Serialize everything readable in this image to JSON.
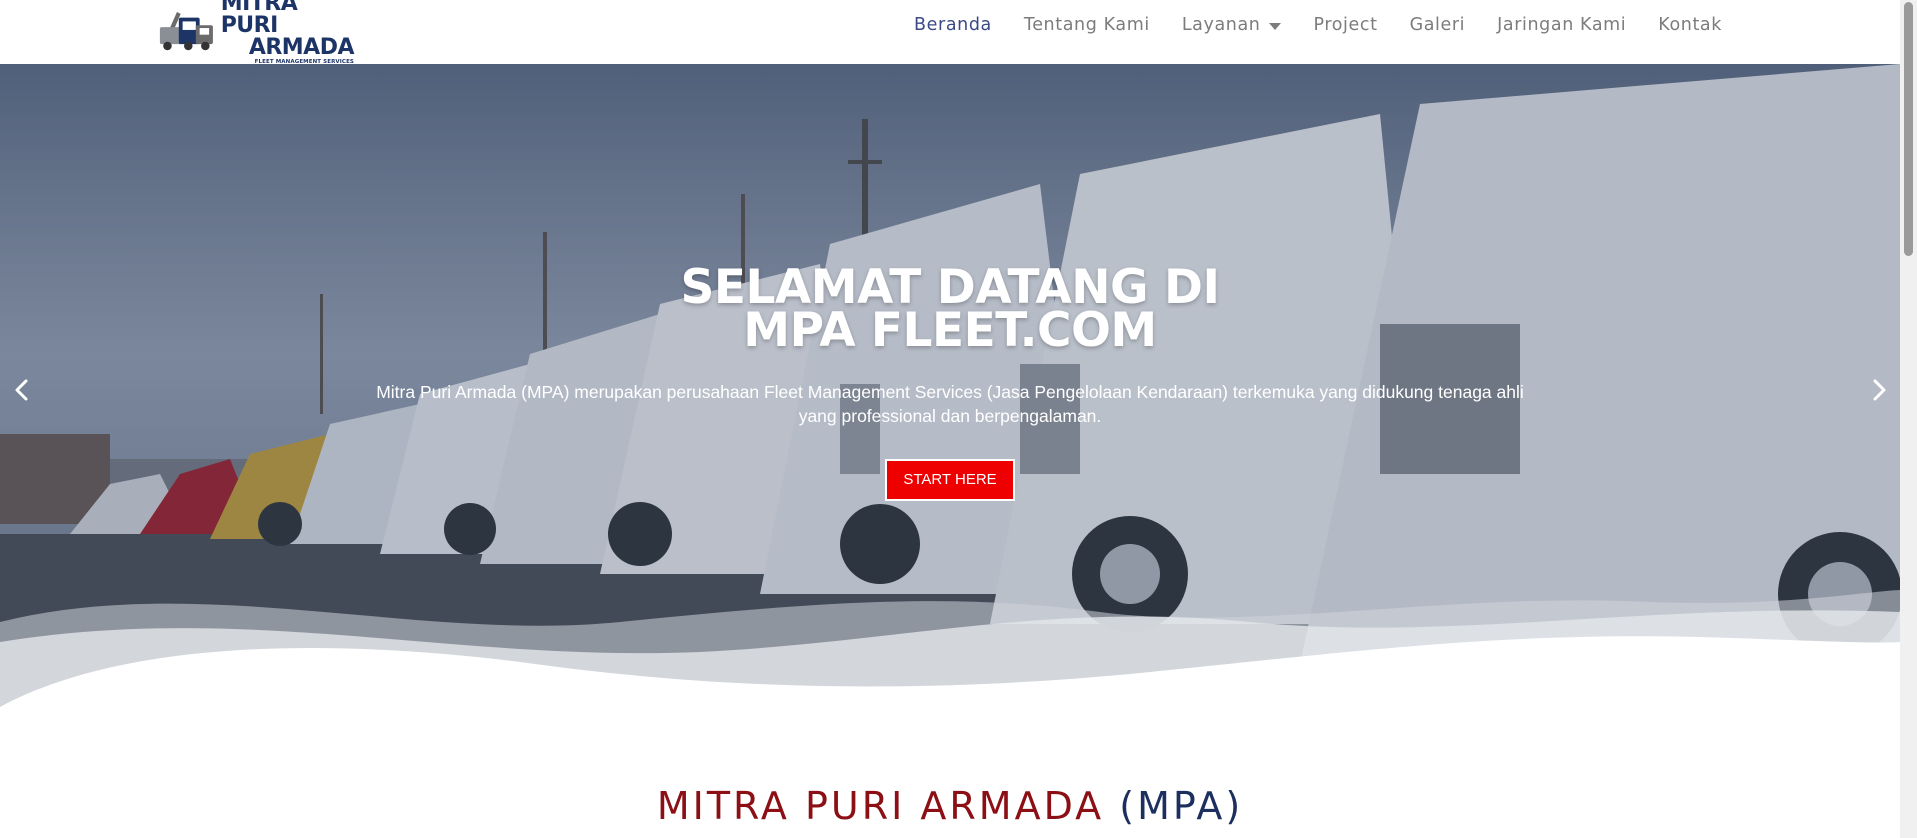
{
  "logo": {
    "line1": "MITRA PURI",
    "line2": "ARMADA",
    "tagline": "FLEET MANAGEMENT SERVICES",
    "icon": "truck-logo-icon"
  },
  "nav": {
    "items": [
      {
        "label": "Beranda",
        "active": true
      },
      {
        "label": "Tentang Kami"
      },
      {
        "label": "Layanan",
        "dropdown": true
      },
      {
        "label": "Project"
      },
      {
        "label": "Galeri"
      },
      {
        "label": "Jaringan Kami"
      },
      {
        "label": "Kontak"
      }
    ]
  },
  "hero": {
    "title_line1": "SELAMAT DATANG DI",
    "title_line2": "MPA FLEET.COM",
    "subtitle": "Mitra Puri Armada (MPA) merupakan perusahaan Fleet Management Services (Jasa Pengelolaan Kendaraan) terkemuka yang didukung tenaga ahli yang professional dan berpengalaman.",
    "button_label": "START HERE",
    "prev_icon": "chevron-left-icon",
    "next_icon": "chevron-right-icon"
  },
  "section": {
    "title_red": "MITRA PURI ARMADA",
    "title_blue": "(MPA)"
  },
  "colors": {
    "brand_navy": "#1d3566",
    "accent_red": "#ee0000",
    "title_red": "#8b0f14",
    "nav_active": "#3b4a85"
  }
}
